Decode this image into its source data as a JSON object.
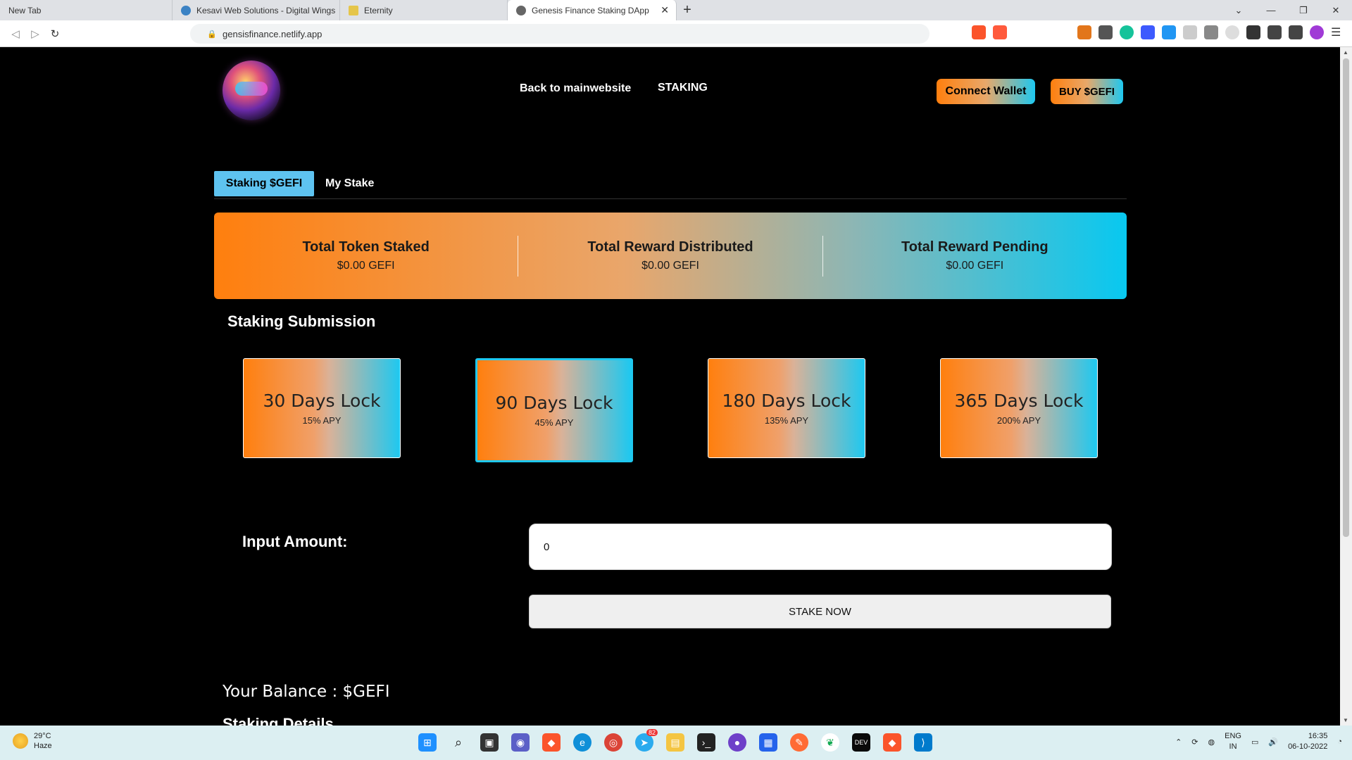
{
  "browser": {
    "tabs": [
      {
        "title": "New Tab",
        "favicon_color": "#dfe1e5"
      },
      {
        "title": "Kesavi Web Solutions - Digital Wings",
        "favicon_color": "#3b82c4"
      },
      {
        "title": "Eternity",
        "favicon_color": "#e5c54a"
      },
      {
        "title": "Genesis Finance Staking DApp",
        "favicon_color": "#666666",
        "active": true
      }
    ],
    "new_tab": "+",
    "url": "gensisfinance.netlify.app"
  },
  "nav": {
    "back_link": "Back to mainwebsite",
    "staking_link": "STAKING",
    "connect_wallet": "Connect Wallet",
    "buy": "BUY $GEFI"
  },
  "tabs": {
    "staking": "Staking $GEFI",
    "my_stake": "My Stake"
  },
  "stats": [
    {
      "label": "Total Token Staked",
      "value": "$0.00 GEFI"
    },
    {
      "label": "Total Reward Distributed",
      "value": "$0.00 GEFI"
    },
    {
      "label": "Total Reward Pending",
      "value": "$0.00 GEFI"
    }
  ],
  "staking": {
    "title": "Staking Submission",
    "locks": [
      {
        "days": "30 Days Lock",
        "apy": "15% APY"
      },
      {
        "days": "90 Days Lock",
        "apy": "45% APY",
        "selected": true
      },
      {
        "days": "180 Days Lock",
        "apy": "135% APY"
      },
      {
        "days": "365 Days Lock",
        "apy": "200% APY"
      }
    ],
    "input_label": "Input Amount:",
    "input_value": "0",
    "stake_button": "STAKE NOW",
    "balance": "Your Balance : $GEFI",
    "details_title": "Staking Details"
  },
  "taskbar": {
    "temperature": "29°C",
    "condition": "Haze",
    "language_1": "ENG",
    "language_2": "IN",
    "time": "16:35",
    "date": "06-10-2022",
    "telegram_badge": "82"
  },
  "colors": {
    "gradient_start": "#ff7f0e",
    "gradient_end": "#1ec8f0",
    "active_tab": "#5ec3f0"
  }
}
